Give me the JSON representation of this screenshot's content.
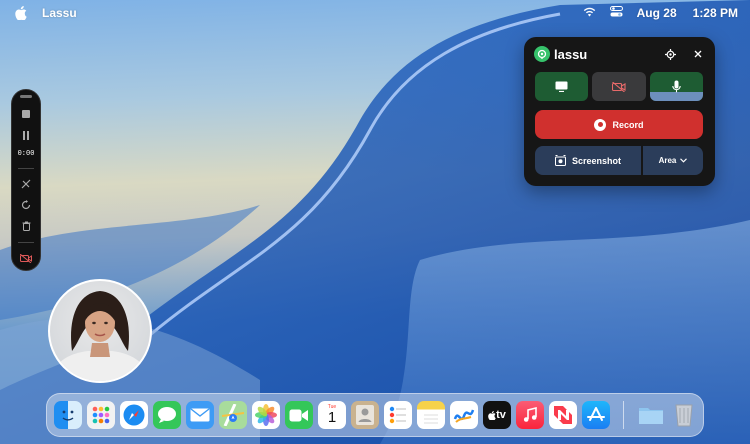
{
  "menubar": {
    "app_name": "Lassu",
    "date": "Aug 28",
    "time": "1:28 PM",
    "icons": [
      "apple-icon",
      "wifi-icon",
      "control-center-icon"
    ]
  },
  "toolbar": {
    "timer": "0:00",
    "buttons": [
      "stop-icon",
      "pause-icon",
      "draw-icon",
      "restart-icon",
      "trash-icon",
      "camera-off-icon"
    ]
  },
  "panel": {
    "brand": "lassu",
    "record_label": "Record",
    "screenshot_label": "Screenshot",
    "area_label": "Area",
    "mic_level": 0.3,
    "sources": [
      "display-icon",
      "camera-off-icon",
      "microphone-icon"
    ]
  },
  "dock": {
    "apps": [
      "Finder",
      "Launchpad",
      "Safari",
      "Messages",
      "Mail",
      "Maps",
      "Photos",
      "FaceTime",
      "Calendar",
      "Contacts",
      "Reminders",
      "Notes",
      "Freeform",
      "TV",
      "Music",
      "News",
      "App Store"
    ],
    "calendar": {
      "month": "Tue",
      "day": "1"
    },
    "tv_label": "tv",
    "extras": [
      "Downloads",
      "Trash"
    ]
  },
  "colors": {
    "accent_green": "#36c26b",
    "record_red": "#d0302e",
    "screenshot_blue": "#2b3d5a"
  }
}
